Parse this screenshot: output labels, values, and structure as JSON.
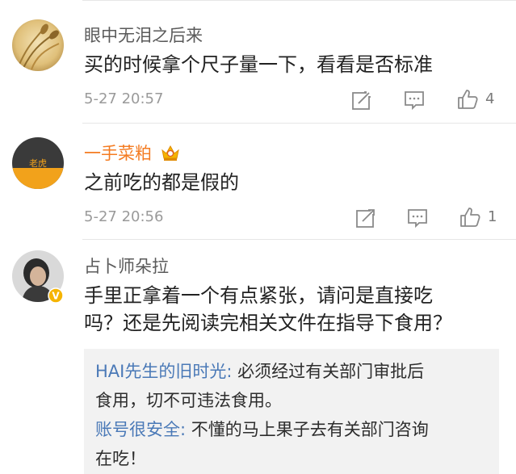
{
  "comments": [
    {
      "username": "眼中无泪之后来",
      "text": "买的时候拿个尺子量一下，看看是否标准",
      "time": "5-27 20:57",
      "likes": "4"
    },
    {
      "username": "一手菜粕",
      "text": "之前吃的都是假的",
      "time": "5-27 20:56",
      "likes": "1",
      "avatar_text": "老虎"
    },
    {
      "username": "占卜师朵拉",
      "text_line1": "手里正拿着一个有点紧张，请问是直接吃",
      "text_line2": "吗？还是先阅读完相关文件在指导下食用？",
      "verified_badge": "V"
    }
  ],
  "replies": [
    {
      "author": "HAI先生的旧时光:",
      "line1": " 必须经过有关部门审批后",
      "line2": "食用，切不可违法食用。"
    },
    {
      "author": "账号很安全:",
      "line1": " 不懂的马上果子去有关部门咨询",
      "line2": "在吃！"
    }
  ],
  "colors": {
    "vip_username": "#f47b21",
    "reply_author": "#4a79b7",
    "verified_badge": "#f5b400"
  },
  "icons": [
    "share-icon",
    "comment-icon",
    "like-icon",
    "vip-crown-icon",
    "verified-badge-icon"
  ]
}
